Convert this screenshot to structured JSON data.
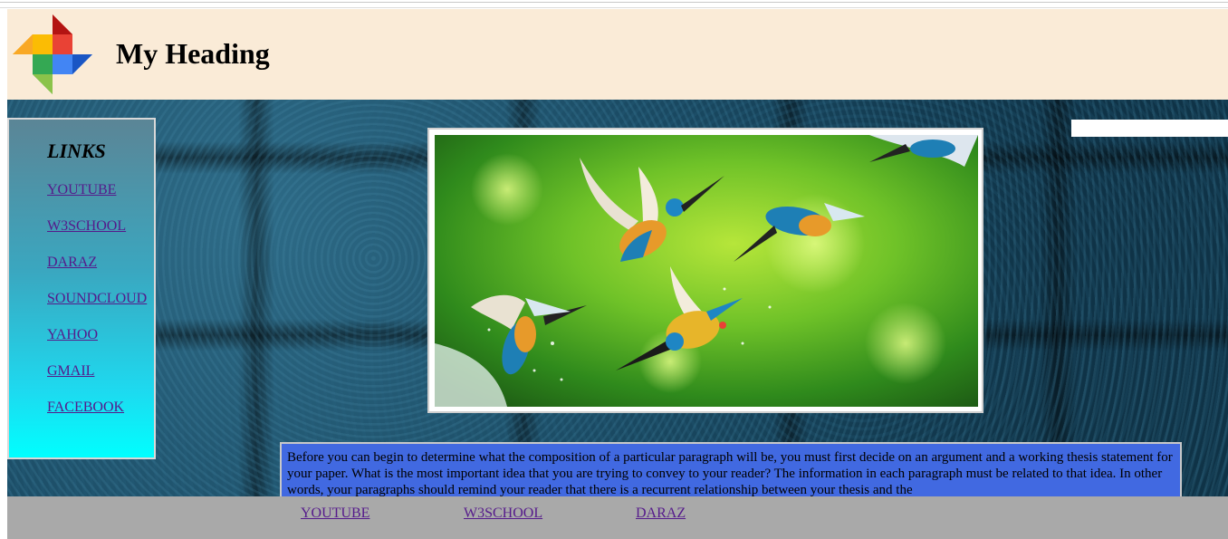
{
  "header": {
    "title": "My Heading",
    "logo_icon": "pinwheel-icon",
    "background": "#faebd7"
  },
  "sidebar": {
    "title": "LINKS",
    "items": [
      {
        "label": "YOUTUBE"
      },
      {
        "label": "W3SCHOOL"
      },
      {
        "label": "DARAZ"
      },
      {
        "label": "SOUNDCLOUD"
      },
      {
        "label": "YAHOO"
      },
      {
        "label": "GMAIL"
      },
      {
        "label": "FACEBOOK"
      }
    ]
  },
  "main": {
    "image_subject": "kingfishers-photo",
    "paragraph": "Before you can begin to determine what the composition of a particular paragraph will be, you must first decide on an argument and a working thesis statement for your paper. What is the most important idea that you are trying to convey to your reader? The information in each paragraph must be related to that idea. In other words, your paragraphs should remind your reader that there is a recurrent relationship between your thesis and the"
  },
  "footer": {
    "links": [
      {
        "label": "YOUTUBE"
      },
      {
        "label": "W3SCHOOL"
      },
      {
        "label": "DARAZ"
      }
    ]
  },
  "colors": {
    "link": "#551a8b",
    "paragraph_bg": "#4169e1",
    "footer_bg": "#a9a9a9"
  }
}
